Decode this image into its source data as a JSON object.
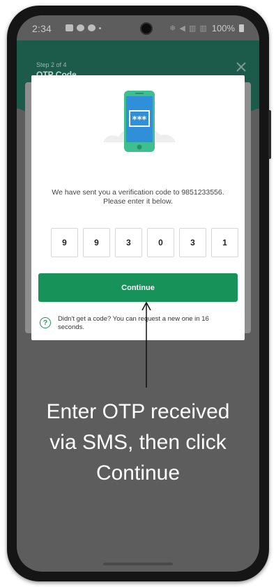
{
  "status_bar": {
    "time": "2:34",
    "system_glyphs": "❄ ◀ ▥ ▥",
    "battery": "100%"
  },
  "header": {
    "step": "Step 2 of 4",
    "title": "OTP Code"
  },
  "modal": {
    "message_line1": "We have sent you a verification code to 9851233556.",
    "message_line2": "Please enter it below.",
    "otp_digits": [
      "9",
      "9",
      "3",
      "0",
      "3",
      "1"
    ],
    "continue_label": "Continue",
    "help_glyph": "?",
    "help_text": "Didn't get a code? You can request a new one in 16 seconds.",
    "illustration_glyph": "***"
  },
  "annotation": {
    "line1": "Enter OTP received",
    "line2": "via SMS, then click",
    "line3": "Continue"
  },
  "colors": {
    "accent_green": "#17935a",
    "header_green": "#1c5b49",
    "phone_screen_blue": "#2f8fd8",
    "phone_body_green": "#3fbf8f"
  }
}
